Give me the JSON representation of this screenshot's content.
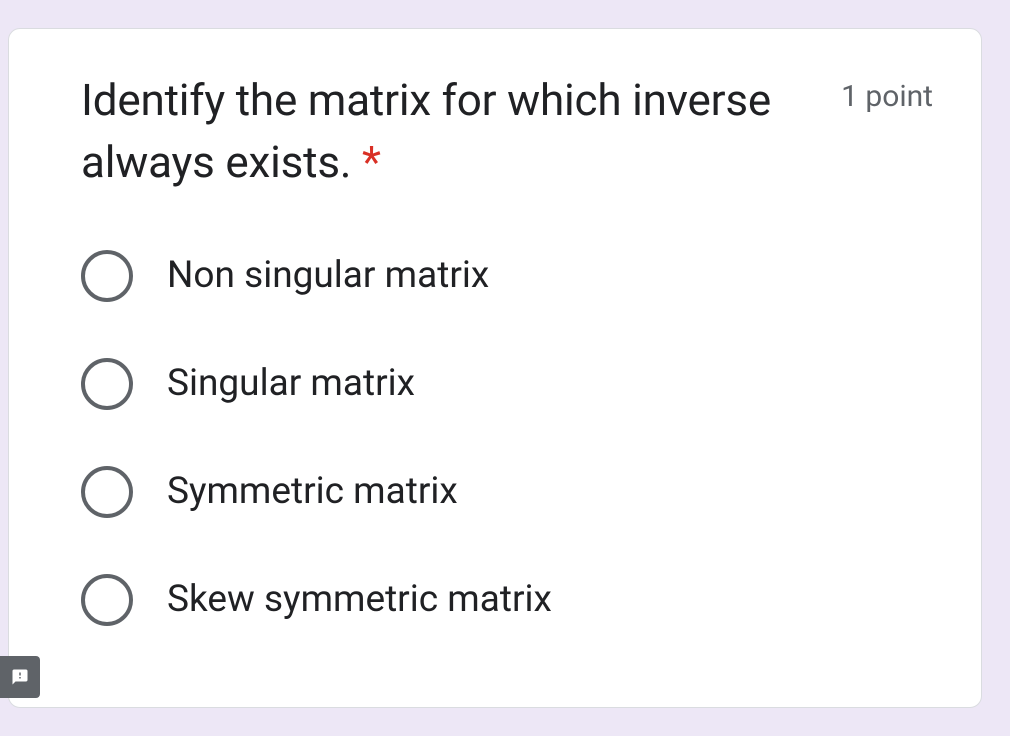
{
  "question": {
    "text": "Identify the matrix for which inverse always exists. ",
    "required_marker": "*",
    "points": "1 point",
    "options": [
      {
        "label": "Non singular matrix"
      },
      {
        "label": "Singular matrix"
      },
      {
        "label": "Symmetric matrix"
      },
      {
        "label": "Skew symmetric matrix"
      }
    ]
  }
}
